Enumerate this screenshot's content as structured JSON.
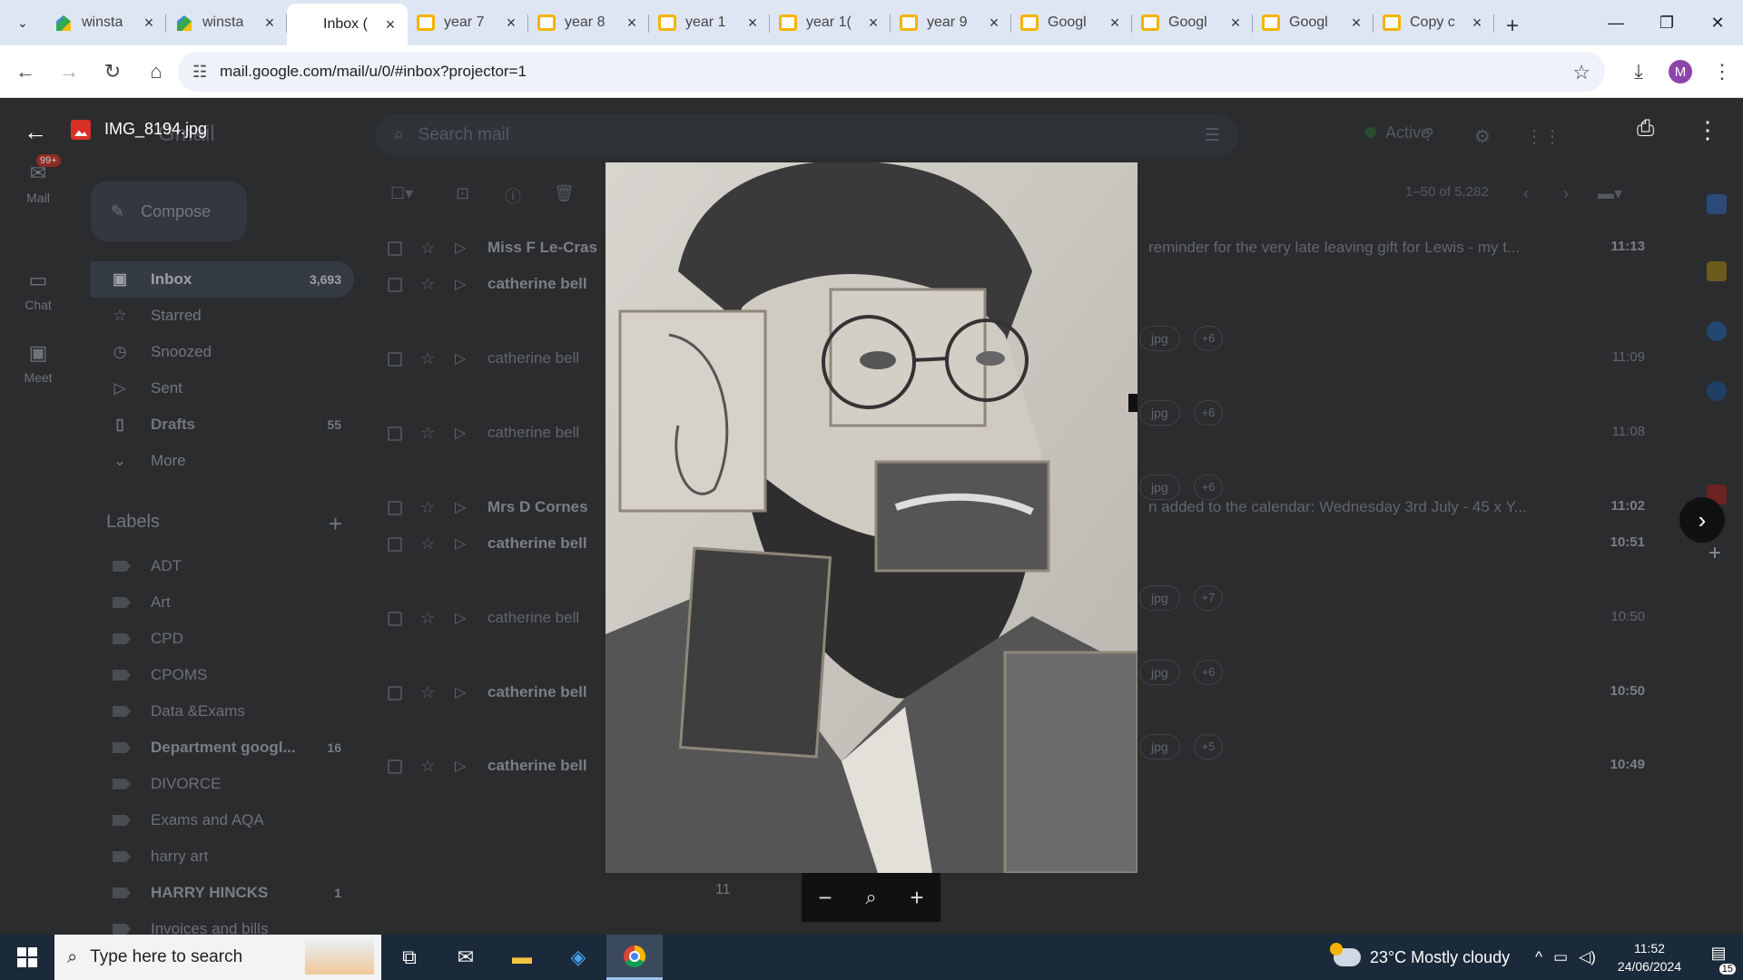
{
  "browser": {
    "tabs": [
      {
        "label": "winsta",
        "icon": "sites"
      },
      {
        "label": "winsta",
        "icon": "sites"
      },
      {
        "label": "Inbox (",
        "icon": "gmail",
        "active": true
      },
      {
        "label": "year 7",
        "icon": "slides"
      },
      {
        "label": "year 8",
        "icon": "slides"
      },
      {
        "label": "year 1",
        "icon": "slides"
      },
      {
        "label": "year 1(",
        "icon": "slides"
      },
      {
        "label": "year 9",
        "icon": "slides"
      },
      {
        "label": "Googl",
        "icon": "slides"
      },
      {
        "label": "Googl",
        "icon": "slides"
      },
      {
        "label": "Googl",
        "icon": "slides"
      },
      {
        "label": "Copy c",
        "icon": "slides"
      }
    ],
    "url": "mail.google.com/mail/u/0/#inbox?projector=1",
    "profile_initial": "M"
  },
  "viewer": {
    "filename": "IMG_8194.jpg",
    "page_number": "11"
  },
  "gmail": {
    "app_name": "Gmail",
    "search_placeholder": "Search mail",
    "status": "Active",
    "rail": {
      "mail": "Mail",
      "chat": "Chat",
      "meet": "Meet",
      "badge": "99+"
    },
    "compose": "Compose",
    "nav": [
      {
        "label": "Inbox",
        "count": "3,693",
        "icon": "inbox"
      },
      {
        "label": "Starred",
        "count": "",
        "icon": "star"
      },
      {
        "label": "Snoozed",
        "count": "",
        "icon": "clock"
      },
      {
        "label": "Sent",
        "count": "",
        "icon": "send"
      },
      {
        "label": "Drafts",
        "count": "55",
        "icon": "draft"
      },
      {
        "label": "More",
        "count": "",
        "icon": "chevron-down"
      }
    ],
    "labels_heading": "Labels",
    "labels": [
      {
        "name": "ADT",
        "count": ""
      },
      {
        "name": "Art",
        "count": ""
      },
      {
        "name": "CPD",
        "count": ""
      },
      {
        "name": "CPOMS",
        "count": ""
      },
      {
        "name": "Data &Exams",
        "count": ""
      },
      {
        "name": "Department googl...",
        "count": "16"
      },
      {
        "name": "DIVORCE",
        "count": ""
      },
      {
        "name": "Exams and AQA",
        "count": ""
      },
      {
        "name": "harry art",
        "count": ""
      },
      {
        "name": "HARRY HINCKS",
        "count": "1"
      },
      {
        "name": "Invoices and bills",
        "count": ""
      }
    ],
    "pagination": "1–50 of 5,282",
    "emails": [
      {
        "sender": "Miss F Le-Cras",
        "snippet": "reminder for the very late leaving gift for Lewis - my t...",
        "time": "11:13",
        "unread": true,
        "attachment": "",
        "more": ""
      },
      {
        "sender": "catherine bell",
        "snippet": "",
        "time": "",
        "unread": true,
        "attachment": "jpg",
        "more": "+6"
      },
      {
        "sender": "catherine bell",
        "snippet": "",
        "time": "11:09",
        "unread": false,
        "attachment": "jpg",
        "more": "+6"
      },
      {
        "sender": "catherine bell",
        "snippet": "",
        "time": "11:08",
        "unread": false,
        "attachment": "jpg",
        "more": "+6"
      },
      {
        "sender": "Mrs D Cornes",
        "snippet": "n added to the calendar: Wednesday 3rd July - 45 x Y...",
        "time": "11:02",
        "unread": true,
        "attachment": "",
        "more": ""
      },
      {
        "sender": "catherine bell",
        "snippet": "",
        "time": "10:51",
        "unread": true,
        "attachment": "jpg",
        "more": "+7"
      },
      {
        "sender": "catherine bell",
        "snippet": "",
        "time": "10:50",
        "unread": false,
        "attachment": "jpg",
        "more": "+6"
      },
      {
        "sender": "catherine bell",
        "snippet": "",
        "time": "10:50",
        "unread": true,
        "attachment": "jpg",
        "more": "+5"
      },
      {
        "sender": "catherine bell",
        "snippet": "",
        "time": "10:49",
        "unread": true,
        "attachment": "",
        "more": ""
      }
    ]
  },
  "taskbar": {
    "search_placeholder": "Type here to search",
    "weather": "23°C  Mostly cloudy",
    "time": "11:52",
    "date": "24/06/2024",
    "notifications": "15"
  }
}
